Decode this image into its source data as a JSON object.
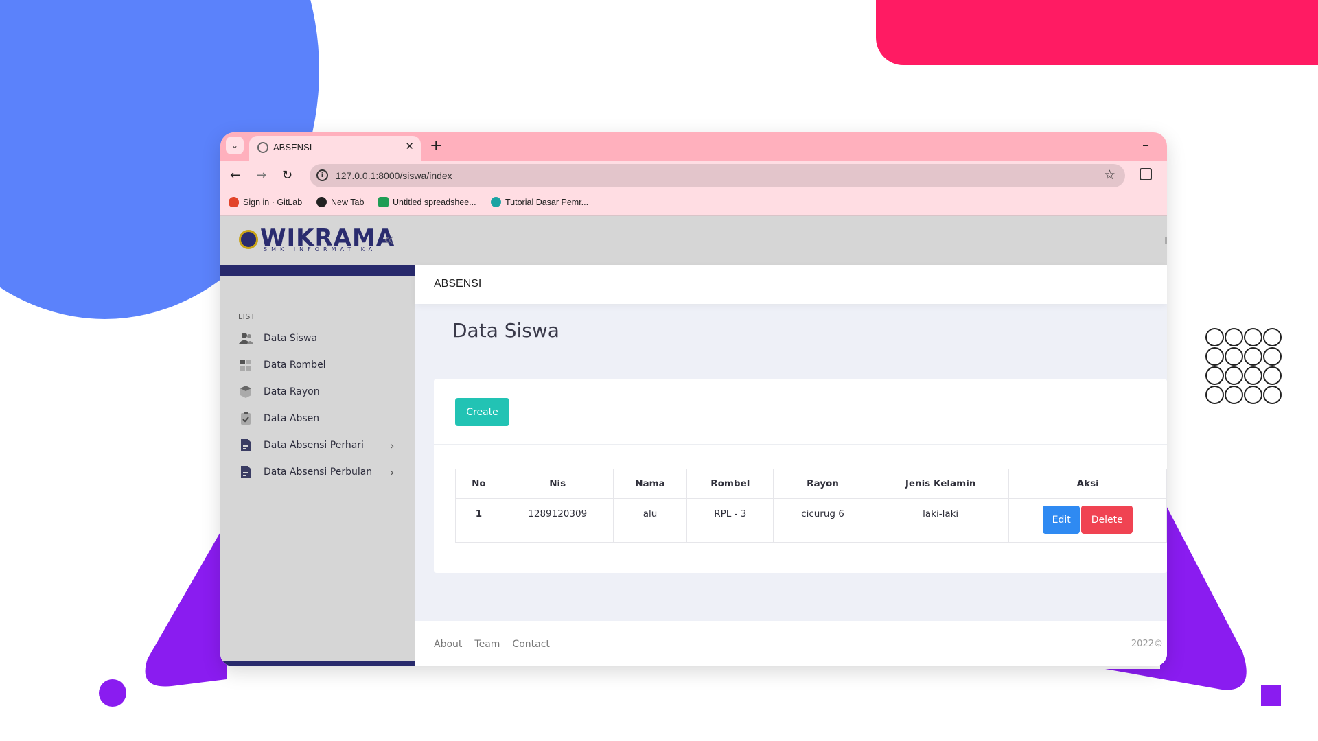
{
  "browser": {
    "tab_title": "ABSENSI",
    "new_tab": "+",
    "minimize": "–",
    "url": "127.0.0.1:8000/siswa/index",
    "bookmarks": [
      {
        "label": "Sign in · GitLab",
        "icon": "gitlab-icon",
        "color": "#e24329"
      },
      {
        "label": "New Tab",
        "icon": "globe-icon",
        "color": "#222222"
      },
      {
        "label": "Untitled spreadshee...",
        "icon": "sheets-icon",
        "color": "#1f9d55"
      },
      {
        "label": "Tutorial Dasar Pemr...",
        "icon": "site-icon",
        "color": "#1aa3a3"
      }
    ]
  },
  "app": {
    "logo_text": "WIKRAMA",
    "logo_subtext": "SMK INFORMATIKA",
    "collapse_icon": "«",
    "sidebar": {
      "heading": "LIST",
      "items": [
        {
          "label": "Data Siswa",
          "icon": "users-icon",
          "has_submenu": false
        },
        {
          "label": "Data Rombel",
          "icon": "grid-icon",
          "has_submenu": false
        },
        {
          "label": "Data Rayon",
          "icon": "cube-icon",
          "has_submenu": false
        },
        {
          "label": "Data Absen",
          "icon": "clipboard-icon",
          "has_submenu": false
        },
        {
          "label": "Data Absensi Perhari",
          "icon": "document-icon",
          "has_submenu": true
        },
        {
          "label": "Data Absensi Perbulan",
          "icon": "document-icon",
          "has_submenu": true
        }
      ],
      "chevron": "›"
    },
    "breadcrumb": "ABSENSI",
    "page_title": "Data Siswa",
    "create_label": "Create",
    "table": {
      "headers": [
        "No",
        "Nis",
        "Nama",
        "Rombel",
        "Rayon",
        "Jenis Kelamin",
        "Aksi"
      ],
      "rows": [
        {
          "no": "1",
          "nis": "1289120309",
          "nama": "alu",
          "rombel": "RPL - 3",
          "rayon": "cicurug 6",
          "jenis_kelamin": "laki-laki"
        }
      ],
      "edit_label": "Edit",
      "delete_label": "Delete"
    },
    "footer": {
      "links": [
        "About",
        "Team",
        "Contact"
      ],
      "copyright": "2022©"
    }
  },
  "colors": {
    "brand_navy": "#282a6c",
    "create_teal": "#22c3b4",
    "edit_blue": "#2f8af2",
    "delete_red": "#f04352",
    "tabbar_pink": "#ffb0bd"
  }
}
